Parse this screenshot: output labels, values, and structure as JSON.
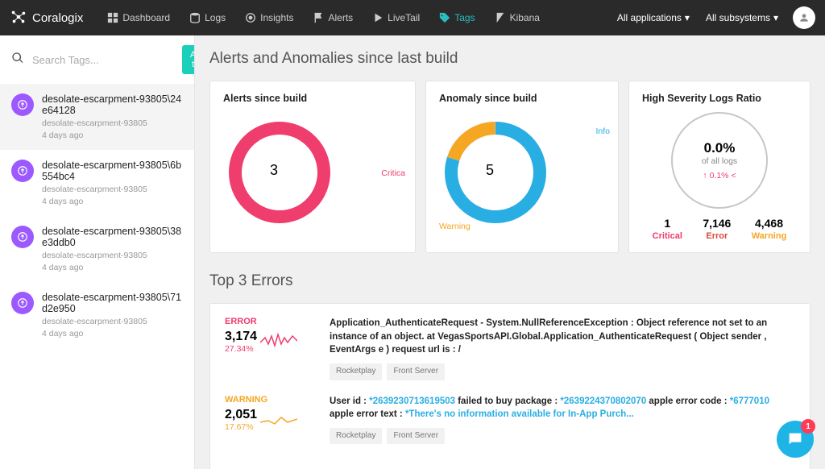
{
  "brand": "Coralogix",
  "nav": [
    {
      "label": "Dashboard",
      "icon": "grid",
      "active": false
    },
    {
      "label": "Logs",
      "icon": "db",
      "active": false
    },
    {
      "label": "Insights",
      "icon": "target",
      "active": false
    },
    {
      "label": "Alerts",
      "icon": "flag",
      "active": false
    },
    {
      "label": "LiveTail",
      "icon": "play",
      "active": false
    },
    {
      "label": "Tags",
      "icon": "tag",
      "active": true
    },
    {
      "label": "Kibana",
      "icon": "kibana",
      "active": false
    }
  ],
  "nav_right": {
    "apps": "All applications",
    "subs": "All subsystems"
  },
  "sidebar": {
    "search_ph": "Search Tags...",
    "add": "Add tag",
    "items": [
      {
        "title": "desolate-escarpment-93805\\24e64128",
        "sub": "desolate-escarpment-93805",
        "time": "4 days ago",
        "sel": true
      },
      {
        "title": "desolate-escarpment-93805\\6b554bc4",
        "sub": "desolate-escarpment-93805",
        "time": "4 days ago",
        "sel": false
      },
      {
        "title": "desolate-escarpment-93805\\38e3ddb0",
        "sub": "desolate-escarpment-93805",
        "time": "4 days ago",
        "sel": false
      },
      {
        "title": "desolate-escarpment-93805\\71d2e950",
        "sub": "desolate-escarpment-93805",
        "time": "4 days ago",
        "sel": false
      }
    ]
  },
  "section1": "Alerts and Anomalies since last build",
  "cards": {
    "alerts": {
      "title": "Alerts since build",
      "value": "3",
      "label": "Critica"
    },
    "anomaly": {
      "title": "Anomaly since build",
      "value": "5",
      "label_warn": "Warning",
      "label_info": "Info"
    },
    "ratio": {
      "title": "High Severity Logs Ratio",
      "pct": "0.0%",
      "sub": "of all logs",
      "delta": "↑ 0.1% <",
      "crit_n": "1",
      "crit_l": "Critical",
      "err_n": "7,146",
      "err_l": "Error",
      "warn_n": "4,468",
      "warn_l": "Warning"
    }
  },
  "section2": "Top 3 Errors",
  "errors": [
    {
      "sev": "ERROR",
      "sev_color": "#ef3d6e",
      "count": "3,174",
      "pct": "27.34%",
      "msg_pre": "Application_AuthenticateRequest - System.NullReferenceException : Object reference not set to an instance of an object. at VegasSportsAPI.Global.Application_AuthenticateRequest ( Object sender , EventArgs e ) request url is : /",
      "chips": [
        "Rocketplay",
        "Front Server"
      ]
    },
    {
      "sev": "WARNING",
      "sev_color": "#f5a623",
      "count": "2,051",
      "pct": "17.67%",
      "chips": [
        "Rocketplay",
        "Front Server"
      ]
    }
  ],
  "warn_msg": {
    "p1": "User id : ",
    "h1": "*2639230713619503",
    "p2": " failed to buy package : ",
    "h2": "*2639224370802070",
    "p3": " apple error code : ",
    "h3": "*6777010",
    "p4": " apple error text : ",
    "h4": "*There's no information available for In-App Purch..."
  },
  "intercom_badge": "1",
  "chart_data": [
    {
      "type": "pie",
      "title": "Alerts since build",
      "series": [
        {
          "name": "Critical",
          "value": 3,
          "color": "#ef3d6e"
        }
      ],
      "center_value": 3
    },
    {
      "type": "pie",
      "title": "Anomaly since build",
      "series": [
        {
          "name": "Info",
          "value": 4,
          "color": "#29aee3"
        },
        {
          "name": "Warning",
          "value": 1,
          "color": "#f5a623"
        }
      ],
      "center_value": 5
    },
    {
      "type": "pie",
      "title": "High Severity Logs Ratio",
      "categories": [
        "Critical",
        "Error",
        "Warning"
      ],
      "values": [
        1,
        7146,
        4468
      ],
      "center_value": "0.0%",
      "delta": "+0.1%"
    }
  ]
}
